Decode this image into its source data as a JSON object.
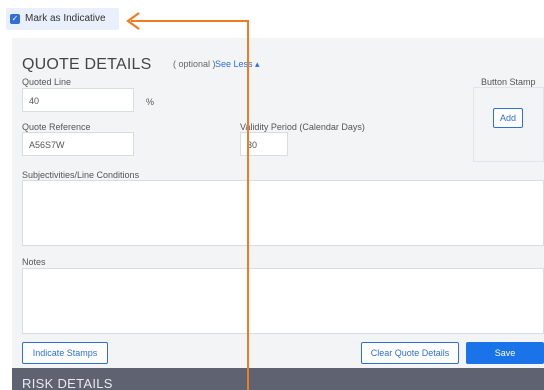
{
  "indicative": {
    "label": "Mark as Indicative",
    "checked": true
  },
  "quote_details": {
    "title": "QUOTE DETAILS",
    "optional": "( optional )",
    "toggle": "See Less ▴",
    "quoted_line": {
      "label": "Quoted Line",
      "value": "40",
      "suffix": "%"
    },
    "quote_reference": {
      "label": "Quote Reference",
      "value": "A56S7W"
    },
    "validity_period": {
      "label": "Validity Period (Calendar Days)",
      "value": "30"
    },
    "subjectivities": {
      "label": "Subjectivities/Line Conditions",
      "value": ""
    },
    "notes": {
      "label": "Notes",
      "value": ""
    },
    "button_stamp": {
      "label": "Button Stamp",
      "add_label": "Add"
    },
    "indicate_stamps_label": "Indicate Stamps",
    "clear_label": "Clear Quote Details",
    "save_label": "Save"
  },
  "risk_details": {
    "title": "RISK DETAILS"
  },
  "colors": {
    "accent": "#2f6fd6",
    "annotation": "#f07b23",
    "panel": "#f3f4f6",
    "risk_bar": "#5f6270"
  }
}
